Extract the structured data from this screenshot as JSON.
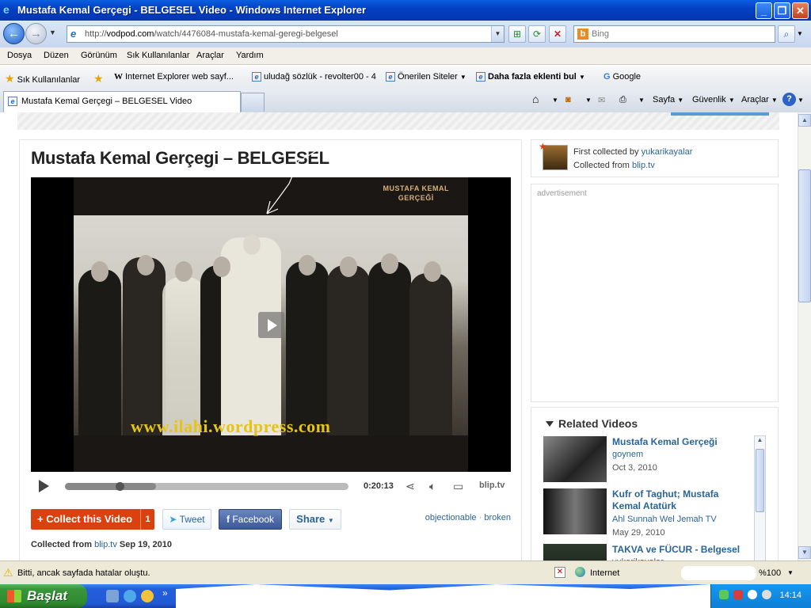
{
  "window": {
    "title": "Mustafa Kemal Gerçegi - BELGESEL Video - Windows Internet Explorer"
  },
  "address": {
    "url_prefix": "http://",
    "url_host": "vodpod.com",
    "url_path": "/watch/4476084-mustafa-kemal-geregi-belgesel",
    "search_placeholder": "Bing"
  },
  "menu": [
    "Dosya",
    "Düzen",
    "Görünüm",
    "Sık Kullanılanlar",
    "Araçlar",
    "Yardım"
  ],
  "favorites": {
    "label": "Sık Kullanılanlar",
    "items": [
      "Internet Explorer web sayf...",
      "uludağ sözlük - revolter00 - 4",
      "Önerilen Siteler",
      "Daha fazla eklenti bul",
      "Google"
    ]
  },
  "tabs": {
    "active": "Mustafa Kemal Gerçegi – BELGESEL Video",
    "toolbar": [
      "Sayfa",
      "Güvenlik",
      "Araçlar"
    ]
  },
  "video": {
    "title": "Mustafa Kemal Gerçegi – BELGESEL",
    "logo_line1": "MUSTAFA KEMAL",
    "logo_line2": "GERÇEĞİ",
    "watermark": "www.ilahi.wordpress.com",
    "time": "0:20:13",
    "provider": "blip.tv",
    "progress": 0.32,
    "buffered": 0.32
  },
  "actions": {
    "collect_label": "+ Collect this Video",
    "collect_count": "1",
    "tweet_label": "Tweet",
    "facebook_label": "Facebook",
    "share_label": "Share",
    "report_objectionable": "objectionable",
    "report_separator": "·",
    "report_broken": "broken"
  },
  "collected": {
    "prefix": "Collected from",
    "source": "blip.tv",
    "date": "Sep 19, 2010"
  },
  "collector": {
    "first_prefix": "First collected by",
    "user": "yukarikayalar",
    "from_prefix": "Collected from",
    "source": "blip.tv"
  },
  "ad": {
    "label": "advertisement"
  },
  "related": {
    "title": "Related Videos",
    "items": [
      {
        "title": "Mustafa Kemal Gerçeği",
        "user": "goynem",
        "date": "Oct 3, 2010"
      },
      {
        "title": "Kufr of Taghut; Mustafa Kemal Atatürk",
        "user": "Ahl Sunnah Wel Jemah TV",
        "date": "May 29, 2010"
      },
      {
        "title": "TAKVA ve FÜCUR - Belgesel",
        "user": "yukarikayalar",
        "date": ""
      }
    ]
  },
  "status": {
    "message": "Bitti, ancak sayfada hatalar oluştu.",
    "zone": "Internet",
    "zoom": "%100"
  },
  "taskbar": {
    "start_label": "Başlat",
    "clock": "14:14"
  },
  "colors": {
    "accent": "#d9420f",
    "link": "#2a6496",
    "facebook": "#3b5998",
    "titlebar": "#0441c4"
  }
}
